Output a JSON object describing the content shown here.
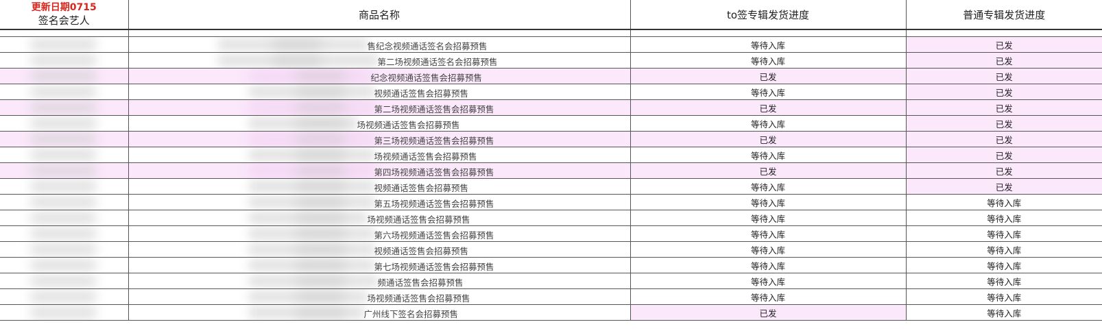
{
  "header": {
    "update_date": "更新日期0715",
    "col_artist": "签名会艺人",
    "col_product": "商品名称",
    "col_to_sign": "to签专辑发货进度",
    "col_normal": "普通专辑发货进度"
  },
  "colors": {
    "highlight_pink": "#fbe8fb",
    "date_red": "#d9261c",
    "border": "#555555"
  },
  "rows": [
    {
      "product": "售纪念视频通话签名会招募预售",
      "to_sign": "等待入库",
      "normal": "已发",
      "to_pink": false,
      "normal_pink": true,
      "row_pink": false
    },
    {
      "product": "第二场视频通话签名会招募预售",
      "to_sign": "等待入库",
      "normal": "已发",
      "to_pink": false,
      "normal_pink": true,
      "row_pink": false
    },
    {
      "product": "纪念视频通话签售会招募预售",
      "to_sign": "已发",
      "normal": "已发",
      "to_pink": true,
      "normal_pink": true,
      "row_pink": true
    },
    {
      "product": "视频通话签售会招募预售",
      "to_sign": "等待入库",
      "normal": "已发",
      "to_pink": false,
      "normal_pink": true,
      "row_pink": false
    },
    {
      "product": "第二场视频通话签售会招募预售",
      "to_sign": "已发",
      "normal": "已发",
      "to_pink": true,
      "normal_pink": true,
      "row_pink": true
    },
    {
      "product": "场视频通话签售会招募预售",
      "to_sign": "等待入库",
      "normal": "已发",
      "to_pink": false,
      "normal_pink": true,
      "row_pink": false
    },
    {
      "product": "第三场视频通话签售会招募预售",
      "to_sign": "已发",
      "normal": "已发",
      "to_pink": true,
      "normal_pink": true,
      "row_pink": true
    },
    {
      "product": "场视频通话签售会招募预售",
      "to_sign": "等待入库",
      "normal": "已发",
      "to_pink": false,
      "normal_pink": true,
      "row_pink": false
    },
    {
      "product": "第四场视频通话签售会招募预售",
      "to_sign": "已发",
      "normal": "已发",
      "to_pink": true,
      "normal_pink": true,
      "row_pink": true
    },
    {
      "product": "视频通话签售会招募预售",
      "to_sign": "等待入库",
      "normal": "已发",
      "to_pink": false,
      "normal_pink": true,
      "row_pink": false
    },
    {
      "product": "第五场视频通话签售会招募预售",
      "to_sign": "等待入库",
      "normal": "等待入库",
      "to_pink": false,
      "normal_pink": false,
      "row_pink": false
    },
    {
      "product": "场视频通话签售会招募预售",
      "to_sign": "等待入库",
      "normal": "等待入库",
      "to_pink": false,
      "normal_pink": false,
      "row_pink": false
    },
    {
      "product": "第六场视频通话签售会招募预售",
      "to_sign": "等待入库",
      "normal": "等待入库",
      "to_pink": false,
      "normal_pink": false,
      "row_pink": false
    },
    {
      "product": "视频通话签售会招募预售",
      "to_sign": "等待入库",
      "normal": "等待入库",
      "to_pink": false,
      "normal_pink": false,
      "row_pink": false
    },
    {
      "product": "第七场视频通话签售会招募预售",
      "to_sign": "等待入库",
      "normal": "等待入库",
      "to_pink": false,
      "normal_pink": false,
      "row_pink": false
    },
    {
      "product": "频通话签售会招募预售",
      "to_sign": "等待入库",
      "normal": "等待入库",
      "to_pink": false,
      "normal_pink": false,
      "row_pink": false
    },
    {
      "product": "场视频通话签售会招募预售",
      "to_sign": "等待入库",
      "normal": "等待入库",
      "to_pink": false,
      "normal_pink": false,
      "row_pink": false
    },
    {
      "product": "广州线下签名会招募预售",
      "to_sign": "已发",
      "normal": "等待入库",
      "to_pink": true,
      "normal_pink": false,
      "row_pink": false
    }
  ]
}
